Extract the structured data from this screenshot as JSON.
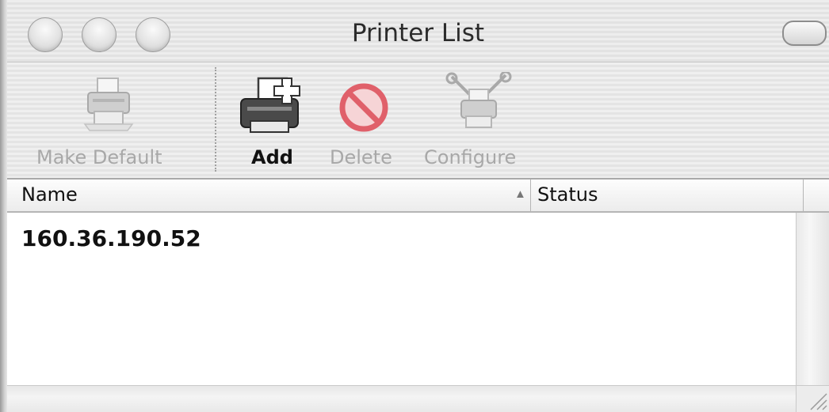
{
  "window": {
    "title": "Printer List"
  },
  "toolbar": {
    "make_default_label": "Make Default",
    "add_label": "Add",
    "delete_label": "Delete",
    "configure_label": "Configure"
  },
  "table": {
    "columns": [
      "Name",
      "Status"
    ],
    "sort_indicator": "▲",
    "rows": [
      {
        "name": "160.36.190.52",
        "status": ""
      }
    ]
  },
  "icons": {
    "make_default": "printer-icon",
    "add": "printer-add-icon",
    "delete": "no-entry-icon",
    "configure": "printer-tools-icon"
  },
  "colors": {
    "delete_red": "#e0606a",
    "disabled_text": "#a8a8a8"
  }
}
